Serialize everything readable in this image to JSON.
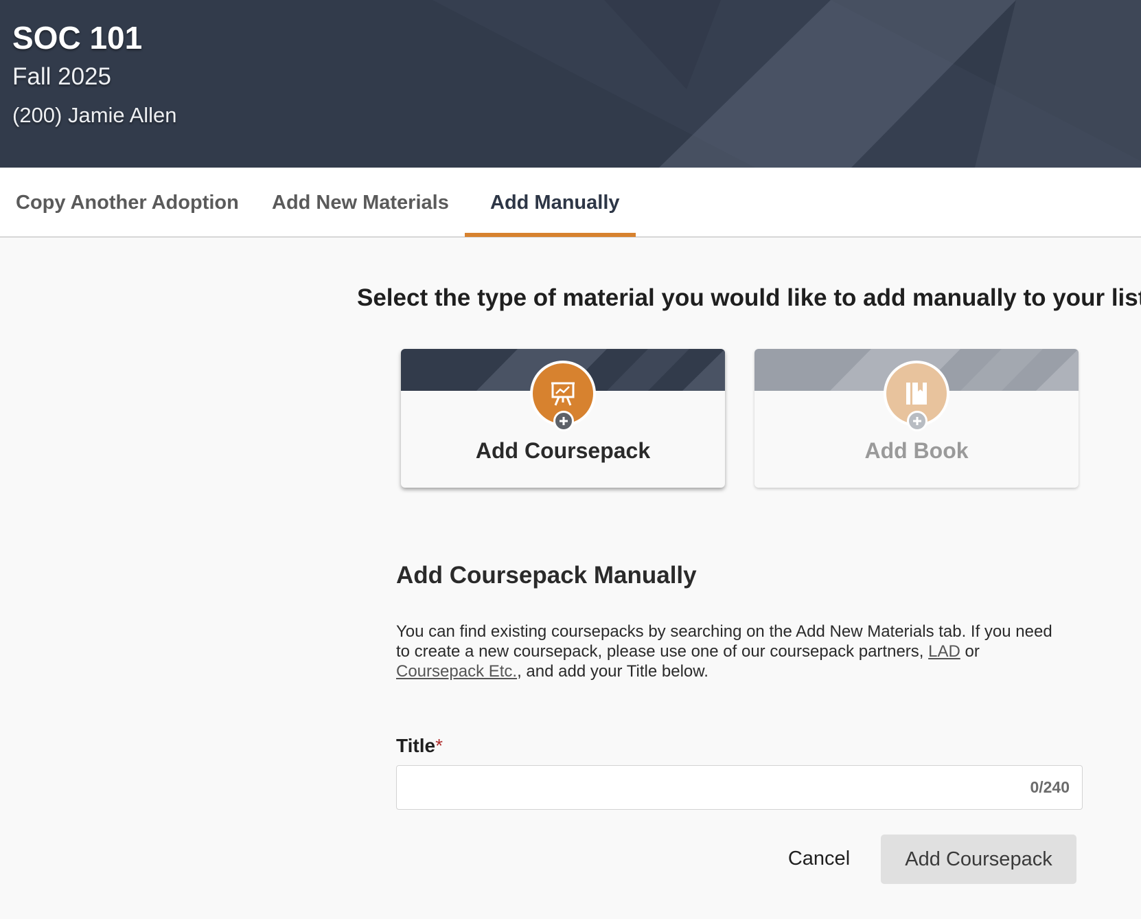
{
  "header": {
    "course_code": "SOC 101",
    "term": "Fall 2025",
    "instructor": "(200) Jamie Allen"
  },
  "tabs": [
    {
      "label": "Copy Another Adoption",
      "active": false
    },
    {
      "label": "Add New Materials",
      "active": false
    },
    {
      "label": "Add Manually",
      "active": true
    }
  ],
  "prompt": "Select the type of material you would like to add manually to your list.",
  "cards": {
    "coursepack": {
      "label": "Add Coursepack",
      "icon": "presentation-board-icon",
      "selected": true
    },
    "book": {
      "label": "Add Book",
      "icon": "book-icon",
      "selected": false
    }
  },
  "section": {
    "title": "Add Coursepack Manually",
    "desc_part1": "You can find existing coursepacks by searching on the Add New Materials tab. If you need to create a new coursepack, please use one of our coursepack partners, ",
    "link_lad": "LAD",
    "desc_part2": " or ",
    "link_etc": "Coursepack Etc.",
    "desc_part3": ", and add your Title below."
  },
  "form": {
    "title_label": "Title",
    "required_mark": "*",
    "title_value": "",
    "counter": "0/240"
  },
  "actions": {
    "cancel_label": "Cancel",
    "submit_label": "Add Coursepack"
  },
  "colors": {
    "header_bg": "#323b4b",
    "accent": "#d7822f",
    "required": "#b03030"
  }
}
